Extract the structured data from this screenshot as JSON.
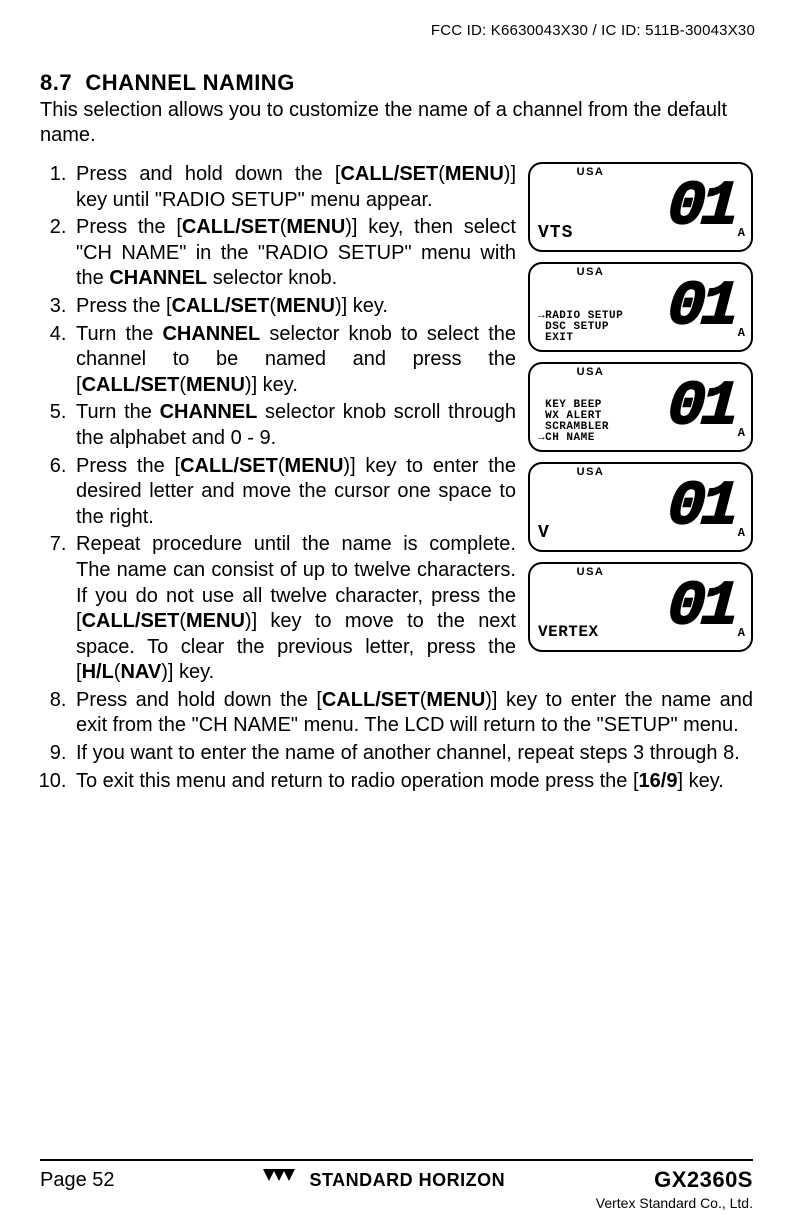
{
  "header_id": "FCC ID: K6630043X30 / IC ID: 511B-30043X30",
  "section_number": "8.7",
  "section_title": "CHANNEL NAMING",
  "intro": "This selection allows you to customize the name of a channel from the default name.",
  "keys": {
    "call_set_menu_open": "[",
    "call_set_menu_label1": "CALL/SET",
    "call_set_menu_paren_open": "(",
    "call_set_menu_label2": "MENU",
    "call_set_menu_paren_close": ")",
    "call_set_menu_close": "]",
    "hl_nav_label1": "H/L",
    "hl_nav_label2": "NAV",
    "sixteen_nine": "16/9"
  },
  "steps_left": [
    {
      "pre": "Press and hold down the ",
      "post": " key until \"RADIO SETUP\" menu appear."
    },
    {
      "pre": "Press the ",
      "mid": " key, then select \"CH NAME\" in the \"RADIO SETUP\" menu with the ",
      "bold_mid": "CHANNEL",
      "post": " selector knob."
    },
    {
      "pre": "Press the ",
      "post": " key."
    },
    {
      "pre": "Turn the ",
      "bold_pre": "CHANNEL",
      "mid": " selector knob to select the channel to be named and press the ",
      "post": " key."
    },
    {
      "pre": "Turn the ",
      "bold_pre": "CHANNEL",
      "post": " selector knob scroll through the alphabet and 0 - 9."
    },
    {
      "pre": "Press the ",
      "post": " key to enter the desired letter and move the cursor one space to the right."
    },
    {
      "pre": "Repeat procedure until the name is complete. The name can consist of up to twelve characters. If you do not use all twelve character, press the ",
      "mid": " key to move to the next space. To clear the previous letter, press the ",
      "hl": true,
      "post": " key."
    }
  ],
  "steps_full": [
    {
      "pre": "Press and hold down the ",
      "post": " key to enter the name and exit from the \"CH NAME\" menu. The LCD will return to the \"SETUP\" menu."
    },
    {
      "text": "If you want to enter the name of another channel, repeat steps 3 through 8."
    },
    {
      "pre": "To exit this menu and return to radio operation mode press the [",
      "bold": "16/9",
      "post": "] key."
    }
  ],
  "lcds": [
    {
      "usa": "USA",
      "left_style": "big",
      "left_text": "VTS",
      "digits": "01",
      "sub": "A"
    },
    {
      "usa": "USA",
      "left_style": "lines",
      "left_lines": [
        "→RADIO SETUP",
        " DSC SETUP",
        " EXIT"
      ],
      "digits": "01",
      "sub": "A"
    },
    {
      "usa": "USA",
      "left_style": "lines",
      "left_lines": [
        " KEY BEEP",
        " WX ALERT",
        " SCRAMBLER",
        "→CH NAME"
      ],
      "digits": "01",
      "sub": "A"
    },
    {
      "usa": "USA",
      "left_style": "big",
      "left_text": "V",
      "digits": "01",
      "sub": "A"
    },
    {
      "usa": "USA",
      "left_style": "mid",
      "left_text": "VERTEX",
      "digits": "01",
      "sub": "A"
    }
  ],
  "footer": {
    "page": "Page 52",
    "brand": "STANDARD HORIZON",
    "model": "GX2360S",
    "vertex": "Vertex Standard Co., Ltd."
  }
}
